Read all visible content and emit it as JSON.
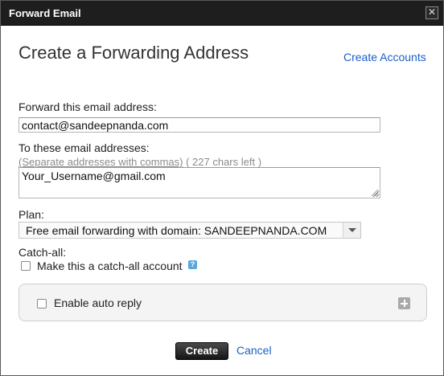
{
  "window": {
    "title": "Forward Email",
    "close_glyph": "✕"
  },
  "header": {
    "heading": "Create a Forwarding Address",
    "create_accounts_link": "Create Accounts"
  },
  "forward_from": {
    "label": "Forward this email address:",
    "value": "contact@sandeepnanda.com"
  },
  "forward_to": {
    "label": "To these email addresses:",
    "hint": "(Separate addresses with commas)",
    "chars_left": "( 227 chars left )",
    "value": "Your_Username@gmail.com"
  },
  "plan": {
    "label": "Plan:",
    "selected": "Free email forwarding with domain: SANDEEPNANDA.COM"
  },
  "catch_all": {
    "label": "Catch-all:",
    "checkbox_label": "Make this a catch-all account",
    "checked": false,
    "help_glyph": "?"
  },
  "auto_reply": {
    "checkbox_label": "Enable auto reply",
    "checked": false
  },
  "actions": {
    "create_label": "Create",
    "cancel_label": "Cancel"
  },
  "colors": {
    "titlebar": "#1e1e1e",
    "link": "#1a5fc8",
    "help_icon": "#5aa7e0"
  }
}
